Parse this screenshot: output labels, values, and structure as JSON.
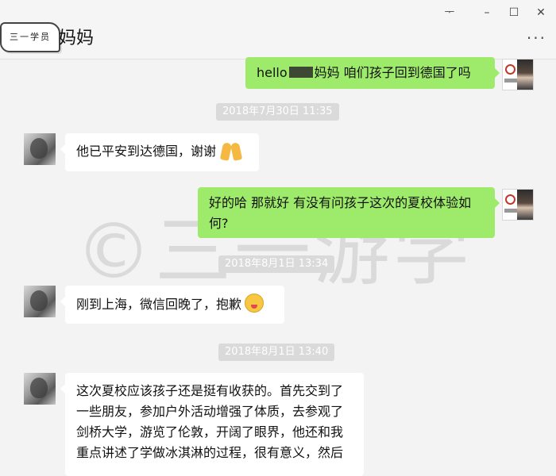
{
  "window": {
    "title": "妈妈",
    "badge": "三一学员",
    "pin_glyph": "ᅮ",
    "minimize_glyph": "–",
    "maximize_glyph": "☐",
    "close_glyph": "✕",
    "more_glyph": "···"
  },
  "watermark": "©三一游学",
  "messages": [
    {
      "side": "out",
      "text_a": "hello",
      "text_b": "妈妈 咱们孩子回到德国了吗"
    },
    {
      "timestamp": "2018年7月30日 11:35"
    },
    {
      "side": "in",
      "text": "他已平安到达德国，谢谢",
      "emoji": "pray-emoji"
    },
    {
      "side": "out",
      "text": "好的哈 那就好 有没有问孩子这次的夏校体验如何?"
    },
    {
      "timestamp": "2018年8月1日 13:34"
    },
    {
      "side": "in",
      "text": "刚到上海，微信回晚了，抱歉",
      "emoji": "tongue-face-emoji"
    },
    {
      "timestamp": "2018年8月1日 13:40"
    },
    {
      "side": "in",
      "text": "这次夏校应该孩子还是挺有收获的。首先交到了一些朋友，参加户外活动增强了体质，去参观了剑桥大学，游览了伦敦，开阔了眼界，他还和我重点讲述了学做冰淇淋的过程，很有意义，然后"
    }
  ],
  "colors": {
    "out_bubble": "#9eea6a",
    "in_bubble": "#ffffff",
    "background": "#f3f3f3",
    "timestamp_bg": "#dadada"
  }
}
